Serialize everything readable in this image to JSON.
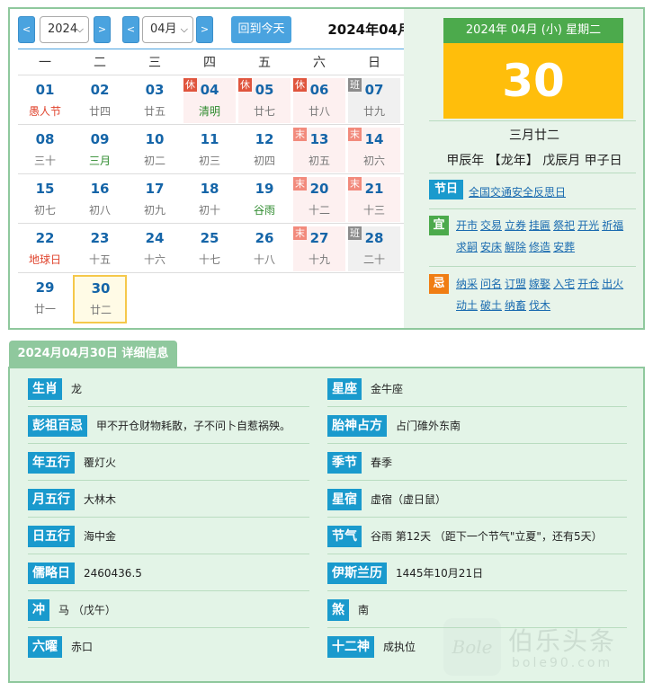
{
  "toolbar": {
    "prev_year": "<",
    "year_value": "2024",
    "next_year": ">",
    "prev_month": "<",
    "month_value": "04月",
    "next_month": ">",
    "today_button": "回到今天",
    "title": "2024年04月"
  },
  "weekdays": [
    "一",
    "二",
    "三",
    "四",
    "五",
    "六",
    "日"
  ],
  "weeks": [
    [
      {
        "day": "01",
        "lunar": "愚人节",
        "lunar_style": "red"
      },
      {
        "day": "02",
        "lunar": "廿四"
      },
      {
        "day": "03",
        "lunar": "廿五"
      },
      {
        "day": "04",
        "lunar": "清明",
        "lunar_style": "green",
        "tag": "休",
        "tag_type": "rest",
        "bg": "hol"
      },
      {
        "day": "05",
        "lunar": "廿七",
        "tag": "休",
        "tag_type": "rest",
        "bg": "hol"
      },
      {
        "day": "06",
        "lunar": "廿八",
        "tag": "休",
        "tag_type": "rest",
        "bg": "hol"
      },
      {
        "day": "07",
        "lunar": "廿九",
        "tag": "班",
        "tag_type": "work",
        "bg": "wk"
      }
    ],
    [
      {
        "day": "08",
        "lunar": "三十"
      },
      {
        "day": "09",
        "lunar": "三月",
        "lunar_style": "green"
      },
      {
        "day": "10",
        "lunar": "初二"
      },
      {
        "day": "11",
        "lunar": "初三"
      },
      {
        "day": "12",
        "lunar": "初四"
      },
      {
        "day": "13",
        "lunar": "初五",
        "tag": "末",
        "tag_type": "weekend",
        "bg": "hol"
      },
      {
        "day": "14",
        "lunar": "初六",
        "tag": "末",
        "tag_type": "weekend",
        "bg": "hol"
      }
    ],
    [
      {
        "day": "15",
        "lunar": "初七"
      },
      {
        "day": "16",
        "lunar": "初八"
      },
      {
        "day": "17",
        "lunar": "初九"
      },
      {
        "day": "18",
        "lunar": "初十"
      },
      {
        "day": "19",
        "lunar": "谷雨",
        "lunar_style": "green"
      },
      {
        "day": "20",
        "lunar": "十二",
        "tag": "末",
        "tag_type": "weekend",
        "bg": "hol"
      },
      {
        "day": "21",
        "lunar": "十三",
        "tag": "末",
        "tag_type": "weekend",
        "bg": "hol"
      }
    ],
    [
      {
        "day": "22",
        "lunar": "地球日",
        "lunar_style": "red"
      },
      {
        "day": "23",
        "lunar": "十五"
      },
      {
        "day": "24",
        "lunar": "十六"
      },
      {
        "day": "25",
        "lunar": "十七"
      },
      {
        "day": "26",
        "lunar": "十八"
      },
      {
        "day": "27",
        "lunar": "十九",
        "tag": "末",
        "tag_type": "weekend",
        "bg": "hol"
      },
      {
        "day": "28",
        "lunar": "二十",
        "tag": "班",
        "tag_type": "work",
        "bg": "wk"
      }
    ],
    [
      {
        "day": "29",
        "lunar": "廿一"
      },
      {
        "day": "30",
        "lunar": "廿二",
        "bg": "today"
      }
    ]
  ],
  "selected": {
    "header": "2024年 04月 (小) 星期二",
    "day": "30",
    "lunar_date": "三月廿二",
    "ganzhi": "甲辰年 【龙年】 戊辰月 甲子日",
    "festival_label": "节日",
    "festivals": [
      "全国交通安全反思日"
    ],
    "yi_label": "宜",
    "yi": [
      "开市",
      "交易",
      "立券",
      "挂匾",
      "祭祀",
      "开光",
      "祈福",
      "求嗣",
      "安床",
      "解除",
      "修造",
      "安葬"
    ],
    "ji_label": "忌",
    "ji": [
      "纳采",
      "问名",
      "订盟",
      "嫁娶",
      "入宅",
      "开仓",
      "出火",
      "动土",
      "破土",
      "纳畜",
      "伐木"
    ]
  },
  "detail": {
    "tab_title": "2024月04月30日 详细信息",
    "rows": [
      [
        {
          "label": "生肖",
          "value": "龙"
        },
        {
          "label": "星座",
          "value": "金牛座"
        }
      ],
      [
        {
          "label": "彭祖百忌",
          "value": "甲不开仓财物耗散，子不问卜自惹祸殃。"
        },
        {
          "label": "胎神占方",
          "value": "占门碓外东南"
        }
      ],
      [
        {
          "label": "年五行",
          "value": "覆灯火"
        },
        {
          "label": "季节",
          "value": "春季"
        }
      ],
      [
        {
          "label": "月五行",
          "value": "大林木"
        },
        {
          "label": "星宿",
          "value": "虚宿（虚日鼠）"
        }
      ],
      [
        {
          "label": "日五行",
          "value": "海中金"
        },
        {
          "label": "节气",
          "value": "谷雨 第12天 （距下一个节气\"立夏\"，还有5天）"
        }
      ],
      [
        {
          "label": "儒略日",
          "value": "2460436.5"
        },
        {
          "label": "伊斯兰历",
          "value": "1445年10月21日"
        }
      ],
      [
        {
          "label": "冲",
          "value": "马 （戊午）"
        },
        {
          "label": "煞",
          "value": "南"
        }
      ],
      [
        {
          "label": "六曜",
          "value": "赤口"
        },
        {
          "label": "十二神",
          "value": "成执位"
        }
      ]
    ]
  },
  "watermark": {
    "logo_text": "Bole",
    "cn_text": "伯乐头条",
    "url_text": "bole90.com"
  }
}
